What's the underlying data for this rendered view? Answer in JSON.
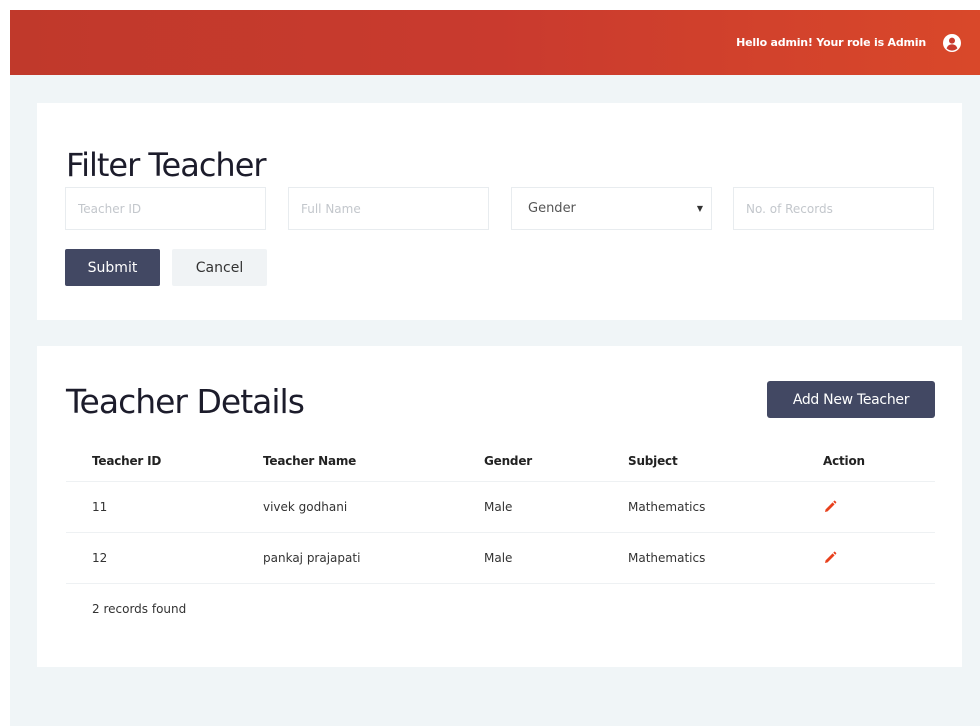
{
  "header": {
    "greeting": "Hello admin! Your role is Admin",
    "user_icon": "user-circle-icon"
  },
  "filter": {
    "title": "Filter Teacher",
    "teacher_id_placeholder": "Teacher ID",
    "full_name_placeholder": "Full Name",
    "gender_selected": "Gender",
    "records_placeholder": "No. of Records",
    "submit_label": "Submit",
    "cancel_label": "Cancel"
  },
  "details": {
    "title": "Teacher Details",
    "add_label": "Add New Teacher",
    "columns": [
      "Teacher ID",
      "Teacher Name",
      "Gender",
      "Subject",
      "Action"
    ],
    "rows": [
      {
        "id": "11",
        "name": "vivek godhani",
        "gender": "Male",
        "subject": "Mathematics"
      },
      {
        "id": "12",
        "name": "pankaj prajapati",
        "gender": "Male",
        "subject": "Mathematics"
      }
    ],
    "footer": "2 records found"
  },
  "colors": {
    "header_start": "#c0392b",
    "header_end": "#d9482a",
    "primary_button": "#424863",
    "edit_icon": "#e8401c"
  }
}
